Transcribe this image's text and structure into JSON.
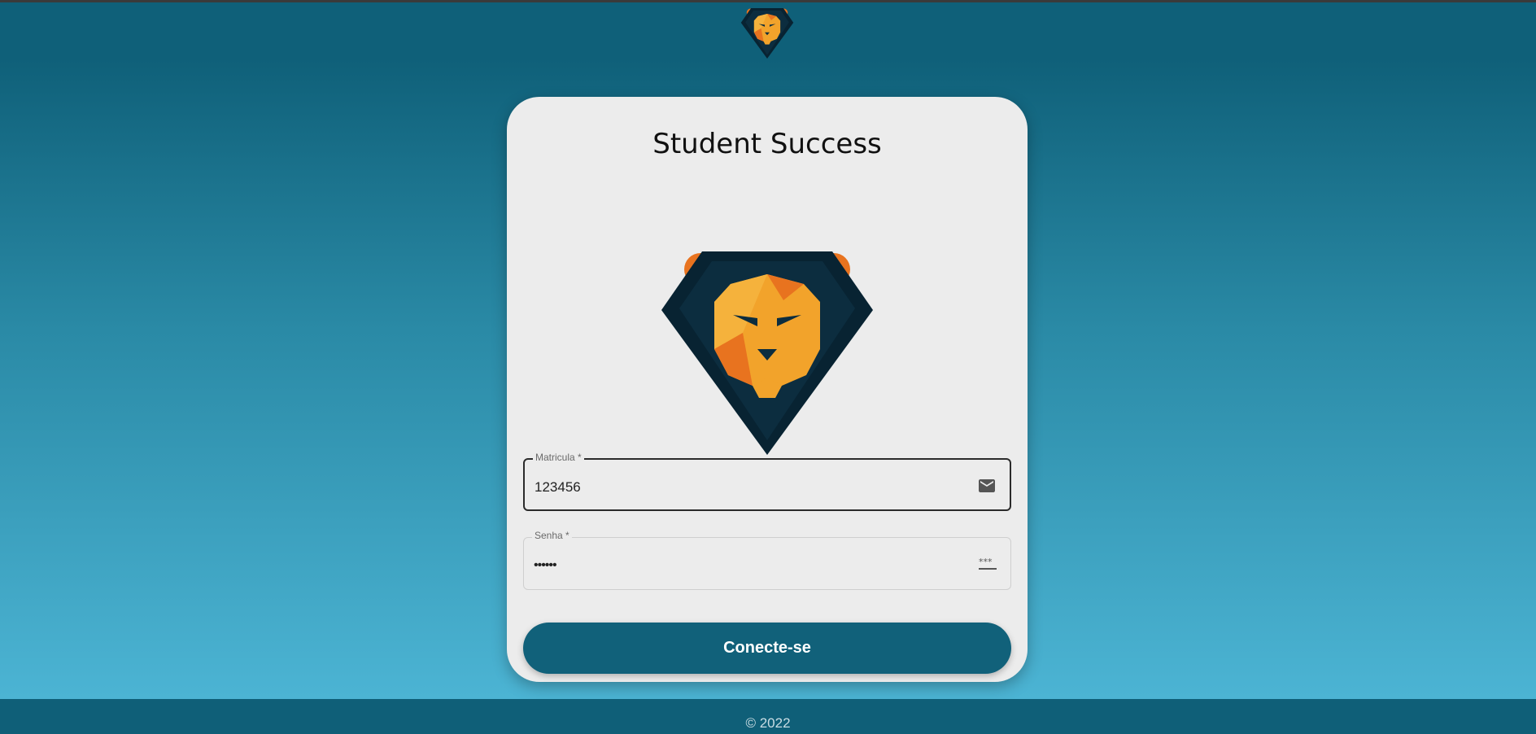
{
  "app": {
    "title": "Student Success"
  },
  "form": {
    "matricula": {
      "label": "Matricula *",
      "value": "123456",
      "icon": "envelope-icon"
    },
    "senha": {
      "label": "Senha *",
      "value": "••••••",
      "icon": "password-dots-icon"
    },
    "submit_label": "Conecte-se"
  },
  "footer": {
    "text": "© 2022"
  },
  "colors": {
    "primary": "#11617a",
    "lion_orange": "#f2a32b",
    "lion_dark_orange": "#e8731f",
    "shield_dark": "#082332"
  }
}
